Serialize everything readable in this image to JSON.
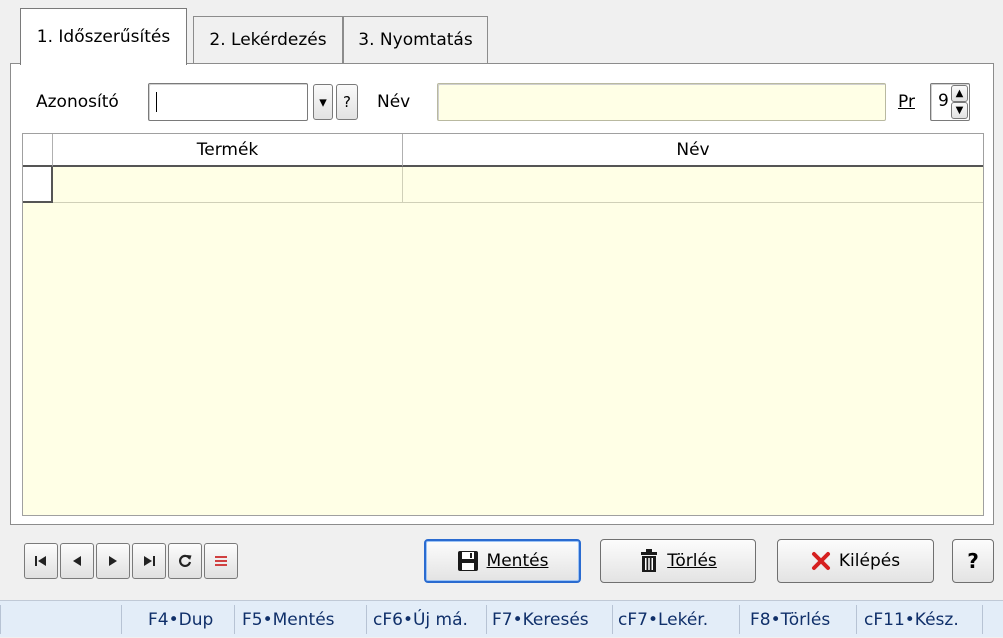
{
  "tabs": [
    {
      "label": "1. Időszerűsítés"
    },
    {
      "label": "2. Lekérdezés"
    },
    {
      "label": "3. Nyomtatás"
    }
  ],
  "form": {
    "azonosito_label": "Azonosító",
    "azonosito_value": "",
    "dropdown_glyph": "▾",
    "help_glyph": "?",
    "nev_label": "Név",
    "nev_value": "",
    "pr_label": "Pr",
    "pr_value": "9"
  },
  "grid": {
    "columns": [
      {
        "label": "Termék"
      },
      {
        "label": "Név"
      }
    ],
    "rows": [
      {
        "termek": "",
        "nev": ""
      }
    ]
  },
  "buttons": {
    "mentes": "Mentés",
    "torles": "Törlés",
    "kilepes": "Kilépés",
    "help": "?"
  },
  "statusbar": [
    {
      "label": "F4•Dup"
    },
    {
      "label": "F5•Mentés"
    },
    {
      "label": "cF6•Új má."
    },
    {
      "label": "F7•Keresés"
    },
    {
      "label": "cF7•Lekér."
    },
    {
      "label": "F8•Törlés"
    },
    {
      "label": "cF11•Kész."
    }
  ],
  "colors": {
    "accent": "#2a6bd0",
    "field_yellow": "#ffffe6",
    "status_bg": "#e3edf8",
    "delete_icon": "#d62020"
  }
}
